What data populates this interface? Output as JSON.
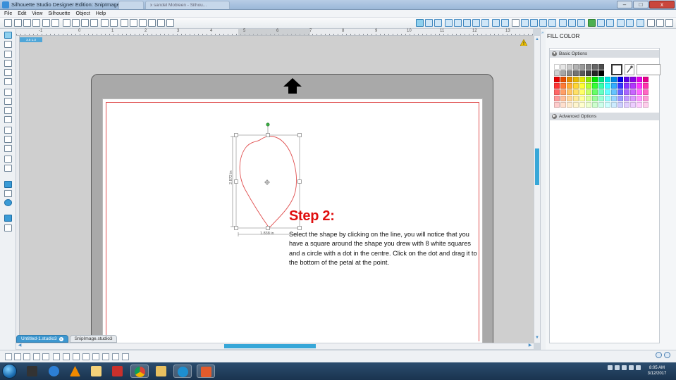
{
  "window": {
    "title": "Silhouette Studio Designer Edition: SnipImage.studio3",
    "background_tabs": [
      "",
      "x  sandel Mobleen - Silhou..."
    ],
    "controls": {
      "minimize": "–",
      "maximize": "□",
      "close": "x"
    }
  },
  "menu": {
    "items": [
      "File",
      "Edit",
      "View",
      "Silhouette",
      "Object",
      "Help"
    ]
  },
  "ruler": {
    "top_numbers": [
      "-1",
      "0",
      "1",
      "2",
      "3",
      "4",
      "5",
      "6",
      "7",
      "8",
      "9",
      "10",
      "11",
      "12",
      "13"
    ],
    "coords": "3.5 1.3"
  },
  "canvas": {
    "shape": {
      "width_label": "1.838 in",
      "height_label": "2.872 in"
    },
    "instruction": {
      "heading": "Step 2:",
      "body": "Select the shape by clicking on the line, you will notice that you have a square around the shape you drew with 8 white squares and a circle with a dot in the centre. Click on the dot and drag it to the bottom of the petal at the point."
    }
  },
  "doc_tabs": [
    {
      "label": "Untitled-1.studio3",
      "active": true,
      "close": "x"
    },
    {
      "label": "SnipImage.studio3",
      "active": false
    }
  ],
  "right_panel": {
    "title": "FILL COLOR",
    "basic_options": "Basic Options",
    "advanced_options": "Advanced Options",
    "gray_swatches": [
      "#ffffff",
      "#e6e6e6",
      "#cccccc",
      "#b3b3b3",
      "#999999",
      "#808080",
      "#666666",
      "#4d4d4d",
      "#d0d0d0",
      "#a6a6a6",
      "#8c8c8c",
      "#737373",
      "#595959",
      "#404040",
      "#262626",
      "#000000"
    ],
    "color_rows": [
      [
        "#e60000",
        "#e64d00",
        "#e68a00",
        "#e6b800",
        "#e6e600",
        "#8ae600",
        "#00e600",
        "#00e68a",
        "#00e6e6",
        "#008ae6",
        "#0000e6",
        "#5c00e6",
        "#8a00e6",
        "#e600e6",
        "#e6008a"
      ],
      [
        "#ff3333",
        "#ff7a33",
        "#ffad33",
        "#ffd633",
        "#ffff33",
        "#b3ff33",
        "#33ff33",
        "#33ffad",
        "#33ffff",
        "#33adff",
        "#3333ff",
        "#8a33ff",
        "#b333ff",
        "#ff33ff",
        "#ff33ad"
      ],
      [
        "#ff6666",
        "#ff9f66",
        "#ffc466",
        "#ffe066",
        "#ffff66",
        "#c9ff66",
        "#66ff66",
        "#66ffc4",
        "#66ffff",
        "#66c4ff",
        "#6666ff",
        "#a866ff",
        "#c966ff",
        "#ff66ff",
        "#ff66c4"
      ],
      [
        "#ff9999",
        "#ffbf99",
        "#ffd699",
        "#ffeb99",
        "#ffff99",
        "#dbff99",
        "#99ff99",
        "#99ffd6",
        "#99ffff",
        "#99d6ff",
        "#9999ff",
        "#c299ff",
        "#db99ff",
        "#ff99ff",
        "#ff99d6"
      ],
      [
        "#ffcccc",
        "#ffdfcc",
        "#ffebcc",
        "#fff5cc",
        "#ffffcc",
        "#edffcc",
        "#ccffcc",
        "#ccffeb",
        "#ccffff",
        "#ccebff",
        "#ccccff",
        "#e0ccff",
        "#edccff",
        "#ffccff",
        "#ffcceb"
      ]
    ]
  },
  "taskbar": {
    "time": "8:05 AM",
    "date": "3/12/2017"
  }
}
